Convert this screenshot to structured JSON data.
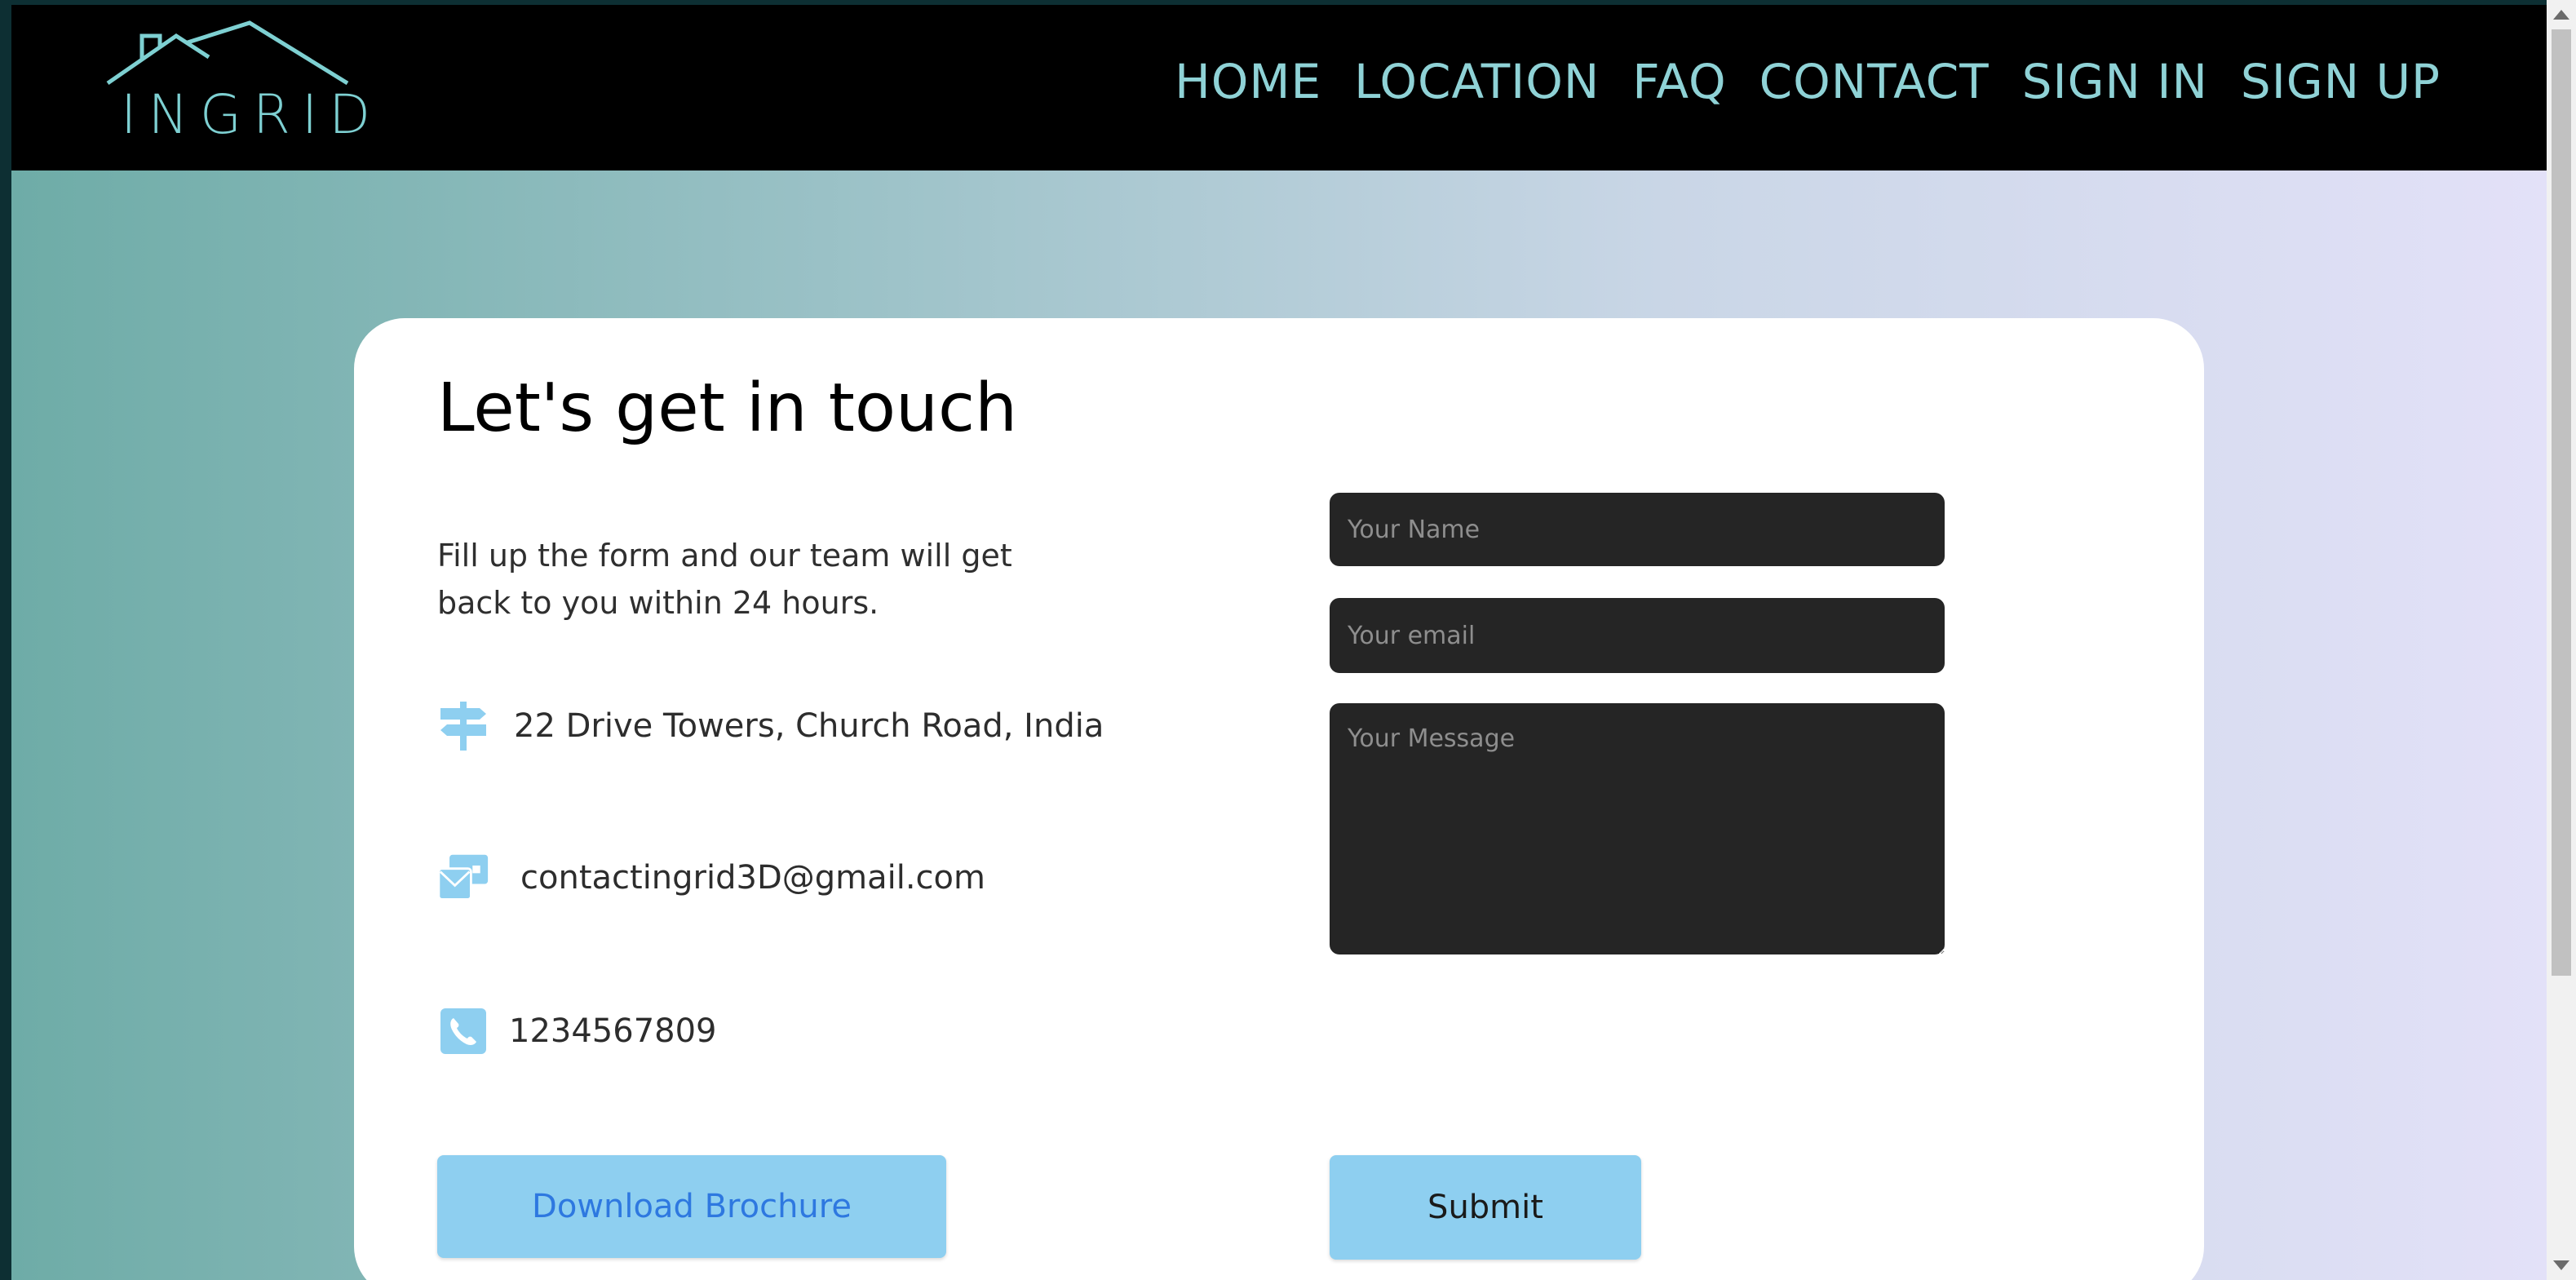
{
  "brand": {
    "logo_text": "INGRID",
    "logo_icon": "house-roof-icon"
  },
  "nav": {
    "items": [
      {
        "label": "HOME"
      },
      {
        "label": "LOCATION"
      },
      {
        "label": "FAQ"
      },
      {
        "label": "CONTACT"
      },
      {
        "label": "SIGN IN"
      },
      {
        "label": "SIGN UP"
      }
    ]
  },
  "contact": {
    "title": "Let's get in touch",
    "subtitle": "Fill up the form and our team will get back to you within 24 hours.",
    "address": {
      "icon": "signpost-icon",
      "text": "22 Drive Towers, Church Road, India"
    },
    "email": {
      "icon": "envelope-icon",
      "text": "contactingrid3D@gmail.com"
    },
    "phone": {
      "icon": "phone-icon",
      "text": "1234567809"
    }
  },
  "form": {
    "name_placeholder": "Your Name",
    "email_placeholder": "Your email",
    "message_placeholder": "Your Message",
    "submit_label": "Submit"
  },
  "actions": {
    "brochure_label": "Download Brochure"
  },
  "colors": {
    "accent": "#8ecff0",
    "nav_text": "#8fd2d6",
    "logo": "#7ed0d2",
    "field_bg": "#252525",
    "brochure_text": "#2e78e0"
  }
}
